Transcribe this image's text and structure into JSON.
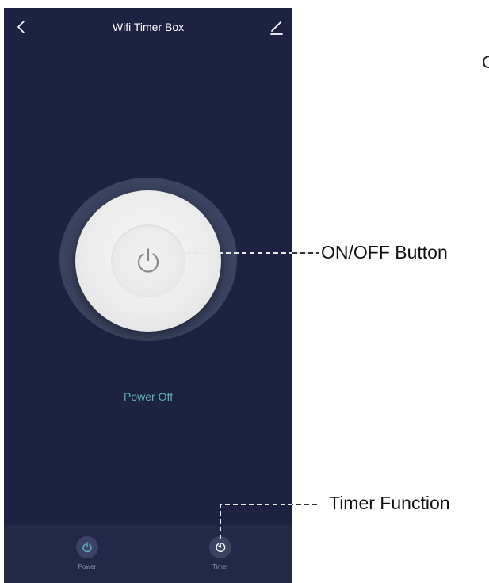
{
  "header": {
    "title": "Wifi Timer Box",
    "back_icon": "chevron-left-icon",
    "edit_icon": "pencil-icon"
  },
  "main": {
    "power_button_icon": "power-icon",
    "status": "Power Off"
  },
  "bottom_nav": {
    "items": [
      {
        "label": "Power",
        "icon": "power-icon"
      },
      {
        "label": "Timer",
        "icon": "timer-icon"
      }
    ]
  },
  "annotations": {
    "power_callout": "ON/OFF Button",
    "timer_callout": "Timer Function",
    "cut_off_text": "C"
  },
  "colors": {
    "screen_background": "#1d2142",
    "bottom_bar": "#232847",
    "status_text": "#5bb3b6",
    "icon_accent": "#5bb3b6"
  }
}
